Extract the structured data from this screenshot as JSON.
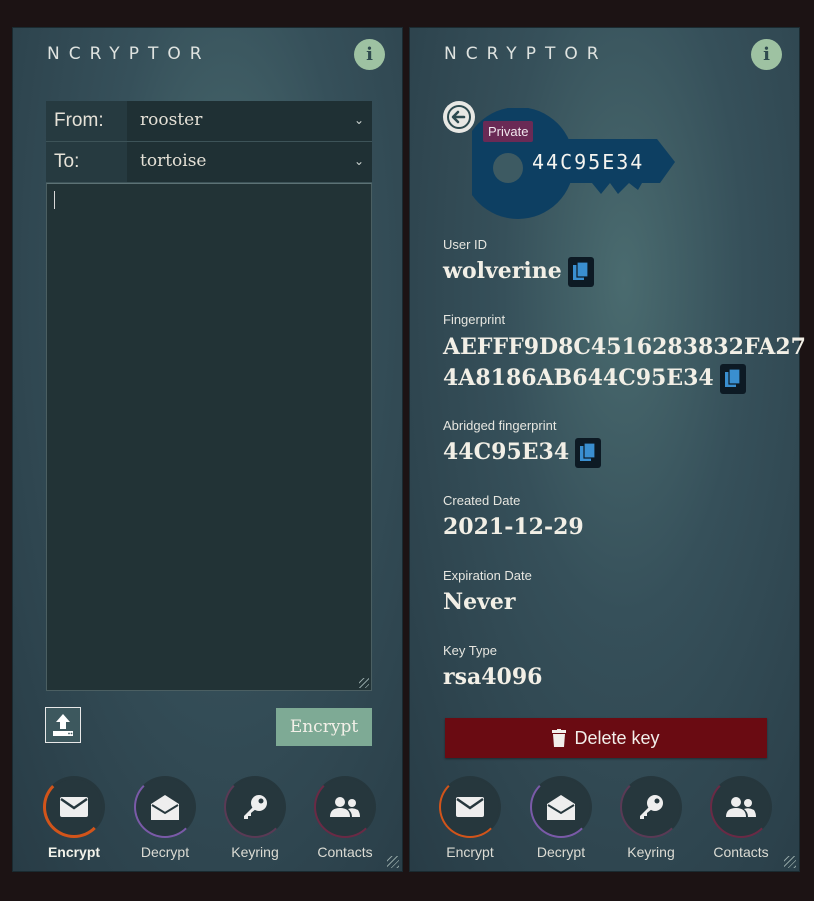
{
  "brand": "NCRYPTOR",
  "encrypt_panel": {
    "from_label": "From:",
    "from_value": "rooster",
    "to_label": "To:",
    "to_value": "tortoise",
    "message_value": "",
    "encrypt_label": "Encrypt"
  },
  "key_panel": {
    "badge": "Private",
    "key_short_id": "44C95E34",
    "fields": {
      "user_id": {
        "label": "User ID",
        "value": "wolverine"
      },
      "fingerprint": {
        "label": "Fingerprint",
        "value_line1": "AEFFF9D8C4516283832FA27",
        "value_line2": "4A8186AB644C95E34"
      },
      "abridged": {
        "label": "Abridged fingerprint",
        "value": "44C95E34"
      },
      "created": {
        "label": "Created Date",
        "value": "2021-12-29"
      },
      "expiration": {
        "label": "Expiration Date",
        "value": "Never"
      },
      "key_type": {
        "label": "Key Type",
        "value": "rsa4096"
      }
    },
    "delete_label": "Delete key"
  },
  "nav": {
    "encrypt": "Encrypt",
    "decrypt": "Decrypt",
    "keyring": "Keyring",
    "contacts": "Contacts"
  },
  "colors": {
    "encrypt_ring": "#d2541a",
    "decrypt_ring": "#7a5aa8",
    "keyring_ring": "#5a3a55",
    "contacts_ring": "#6a2a45",
    "key_graphic": "#0d3f62",
    "badge": "#6a2a55",
    "delete": "#6a0b12",
    "encrypt_button": "#7eaa95"
  }
}
